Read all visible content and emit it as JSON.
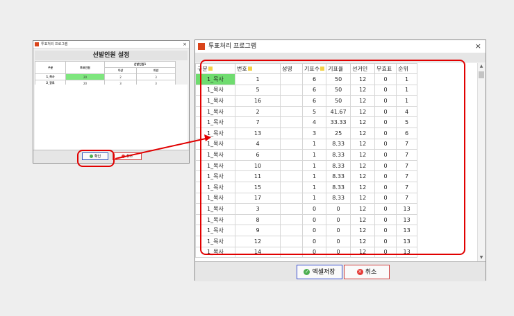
{
  "small_window": {
    "title": "투표처리 프로그램",
    "close": "×",
    "heading": "선발인원 설정",
    "headers": {
      "col1": "구분",
      "col2": "투표인원",
      "col3": "선발인원1",
      "sub1": "이상",
      "sub2": "미만"
    },
    "rows": [
      {
        "label": "1_목사",
        "v1": "20",
        "v2": "2",
        "v3": "3"
      },
      {
        "label": "2_장로",
        "v1": "20",
        "v2": "3",
        "v3": "3"
      }
    ],
    "confirm_label": "확인",
    "cancel_label": "취소"
  },
  "big_window": {
    "title": "투표처리 프로그램",
    "close": "×",
    "columns": [
      "구분",
      "번호",
      "성명",
      "기표수",
      "기표율",
      "선거인",
      "무효표",
      "순위"
    ],
    "rows": [
      {
        "c": "1_목사",
        "n": "1",
        "name": "",
        "votes": "6",
        "rate": "50",
        "electors": "12",
        "invalid": "0",
        "rank": "1"
      },
      {
        "c": "1_목사",
        "n": "5",
        "name": "",
        "votes": "6",
        "rate": "50",
        "electors": "12",
        "invalid": "0",
        "rank": "1"
      },
      {
        "c": "1_목사",
        "n": "16",
        "name": "",
        "votes": "6",
        "rate": "50",
        "electors": "12",
        "invalid": "0",
        "rank": "1"
      },
      {
        "c": "1_목사",
        "n": "2",
        "name": "",
        "votes": "5",
        "rate": "41.67",
        "electors": "12",
        "invalid": "0",
        "rank": "4"
      },
      {
        "c": "1_목사",
        "n": "7",
        "name": "",
        "votes": "4",
        "rate": "33.33",
        "electors": "12",
        "invalid": "0",
        "rank": "5"
      },
      {
        "c": "1_목사",
        "n": "13",
        "name": "",
        "votes": "3",
        "rate": "25",
        "electors": "12",
        "invalid": "0",
        "rank": "6"
      },
      {
        "c": "1_목사",
        "n": "4",
        "name": "",
        "votes": "1",
        "rate": "8.33",
        "electors": "12",
        "invalid": "0",
        "rank": "7"
      },
      {
        "c": "1_목사",
        "n": "6",
        "name": "",
        "votes": "1",
        "rate": "8.33",
        "electors": "12",
        "invalid": "0",
        "rank": "7"
      },
      {
        "c": "1_목사",
        "n": "10",
        "name": "",
        "votes": "1",
        "rate": "8.33",
        "electors": "12",
        "invalid": "0",
        "rank": "7"
      },
      {
        "c": "1_목사",
        "n": "11",
        "name": "",
        "votes": "1",
        "rate": "8.33",
        "electors": "12",
        "invalid": "0",
        "rank": "7"
      },
      {
        "c": "1_목사",
        "n": "15",
        "name": "",
        "votes": "1",
        "rate": "8.33",
        "electors": "12",
        "invalid": "0",
        "rank": "7"
      },
      {
        "c": "1_목사",
        "n": "17",
        "name": "",
        "votes": "1",
        "rate": "8.33",
        "electors": "12",
        "invalid": "0",
        "rank": "7"
      },
      {
        "c": "1_목사",
        "n": "3",
        "name": "",
        "votes": "0",
        "rate": "0",
        "electors": "12",
        "invalid": "0",
        "rank": "13"
      },
      {
        "c": "1_목사",
        "n": "8",
        "name": "",
        "votes": "0",
        "rate": "0",
        "electors": "12",
        "invalid": "0",
        "rank": "13"
      },
      {
        "c": "1_목사",
        "n": "9",
        "name": "",
        "votes": "0",
        "rate": "0",
        "electors": "12",
        "invalid": "0",
        "rank": "13"
      },
      {
        "c": "1_목사",
        "n": "12",
        "name": "",
        "votes": "0",
        "rate": "0",
        "electors": "12",
        "invalid": "0",
        "rank": "13"
      },
      {
        "c": "1_목사",
        "n": "14",
        "name": "",
        "votes": "0",
        "rate": "0",
        "electors": "12",
        "invalid": "0",
        "rank": "13"
      }
    ],
    "save_label": "엑셀저장",
    "cancel_label": "취소"
  },
  "colors": {
    "accent_red": "#e10000",
    "selected_green": "#6fdc6f",
    "app_icon": "#d9441a"
  }
}
